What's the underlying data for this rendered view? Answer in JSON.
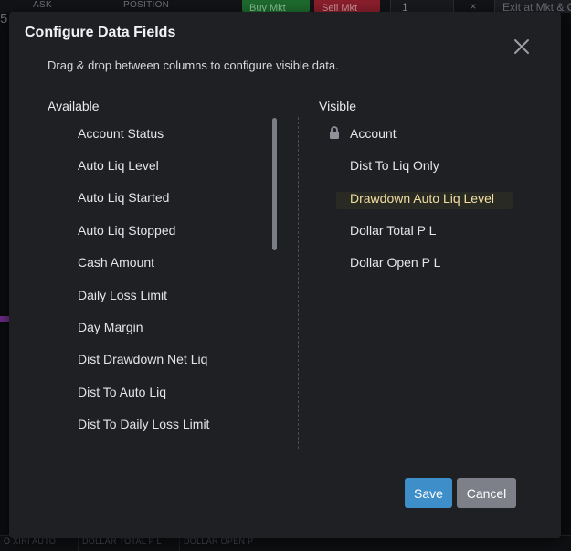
{
  "background": {
    "labels": {
      "ask": "ASK",
      "position": "POSITION"
    },
    "buy_button": "Buy Mkt",
    "sell_button": "Sell Mkt",
    "quantity": "1",
    "close_glyph": "×",
    "exit_button": "Exit at Mkt & Cxl",
    "left_number": "5",
    "bottom_columns": [
      "O XIRI AUTO",
      "DOLLAR TOTAL P L",
      "DOLLAR OPEN P"
    ]
  },
  "modal": {
    "title": "Configure Data Fields",
    "instructions": "Drag & drop between columns to configure visible data.",
    "close_icon": "close-icon",
    "available": {
      "header": "Available",
      "items": [
        "Account Status",
        "Auto Liq Level",
        "Auto Liq Started",
        "Auto Liq Stopped",
        "Cash Amount",
        "Daily Loss Limit",
        "Day Margin",
        "Dist Drawdown Net Liq",
        "Dist To Auto Liq",
        "Dist To Daily Loss Limit"
      ]
    },
    "visible": {
      "header": "Visible",
      "lock_icon": "lock-icon",
      "items": [
        "Account",
        "Dist To Liq Only",
        "Drawdown Auto Liq Level",
        "Dollar Total P L",
        "Dollar Open P L"
      ],
      "highlighted_item": "Drawdown Auto Liq Level"
    },
    "buttons": {
      "save": "Save",
      "cancel": "Cancel"
    }
  },
  "colors": {
    "save_button": "#3d8ec9",
    "cancel_button": "#7d8089",
    "highlight_text": "#f0dda0",
    "modal_background": "#1f2024"
  }
}
